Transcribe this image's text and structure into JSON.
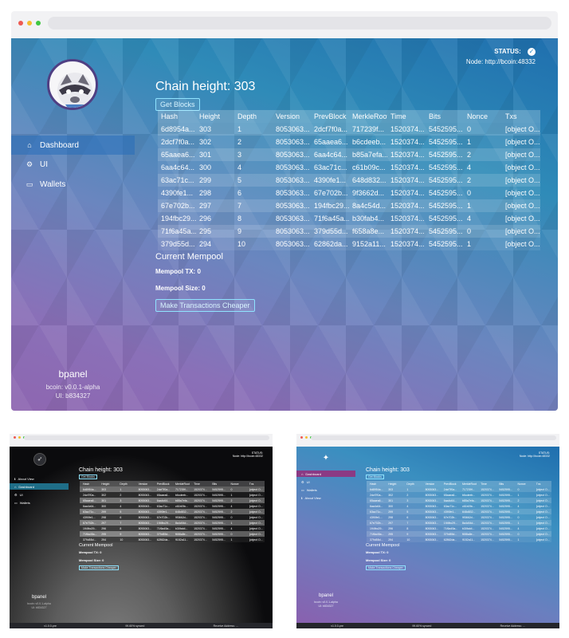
{
  "main": {
    "status_label": "STATUS:",
    "node_text": "Node: http://bcoin:48332",
    "nav": [
      {
        "label": "Dashboard",
        "icon": "home-icon",
        "glyph": "⌂"
      },
      {
        "label": "UI",
        "icon": "cogs-icon",
        "glyph": "⚙"
      },
      {
        "label": "Wallets",
        "icon": "wallet-icon",
        "glyph": "▭"
      }
    ],
    "brand": {
      "name": "bpanel",
      "bcoin_version": "bcoin: v0.0.1-alpha",
      "ui_version": "UI: b834327"
    },
    "chain_height_title": "Chain height: 303",
    "get_blocks_label": "Get Blocks",
    "columns": [
      "Hash",
      "Height",
      "Depth",
      "Version",
      "PrevBlock",
      "MerkleRoot",
      "Time",
      "Bits",
      "Nonce",
      "Txs"
    ],
    "rows": [
      [
        "6d8954a...",
        "303",
        "1",
        "8053063...",
        "2dcf7f0a...",
        "717239f...",
        "1520374...",
        "5452595...",
        "0",
        "[object O..."
      ],
      [
        "2dcf7f0a...",
        "302",
        "2",
        "8053063...",
        "65aaea6...",
        "b6cdeeb...",
        "1520374...",
        "5452595...",
        "1",
        "[object O..."
      ],
      [
        "65aaea6...",
        "301",
        "3",
        "8053063...",
        "6aa4c64...",
        "b85a7efa...",
        "1520374...",
        "5452595...",
        "2",
        "[object O..."
      ],
      [
        "6aa4c64...",
        "300",
        "4",
        "8053063...",
        "63ac71c...",
        "c61b09c...",
        "1520374...",
        "5452595...",
        "4",
        "[object O..."
      ],
      [
        "63ac71c...",
        "299",
        "5",
        "8053063...",
        "4390fe1...",
        "648d832...",
        "1520374...",
        "5452595...",
        "2",
        "[object O..."
      ],
      [
        "4390fe1...",
        "298",
        "6",
        "8053063...",
        "67e702b...",
        "9f3662d...",
        "1520374...",
        "5452595...",
        "0",
        "[object O..."
      ],
      [
        "67e702b...",
        "297",
        "7",
        "8053063...",
        "194fbc29...",
        "8a4c54d...",
        "1520374...",
        "5452595...",
        "1",
        "[object O..."
      ],
      [
        "194fbc29...",
        "296",
        "8",
        "8053063...",
        "71f6a45a...",
        "b30fab4...",
        "1520374...",
        "5452595...",
        "4",
        "[object O..."
      ],
      [
        "71f6a45a...",
        "295",
        "9",
        "8053063...",
        "379d55d...",
        "f658a8e...",
        "1520374...",
        "5452595...",
        "0",
        "[object O..."
      ],
      [
        "379d55d...",
        "294",
        "10",
        "8053063...",
        "62862da...",
        "9152a11...",
        "1520374...",
        "5452595...",
        "1",
        "[object O..."
      ]
    ],
    "mempool_title": "Current Mempool",
    "mempool_tx": "Mempool TX: 0",
    "mempool_size": "Mempool Size: 0",
    "cheaper_button": "Make Transactions Cheaper"
  },
  "dark_thumb": {
    "status_label": "STATUS:",
    "node_text": "Node: http://bcoin:48332",
    "nav": [
      {
        "label": "About View",
        "icon": "info-icon",
        "glyph": "ℹ"
      },
      {
        "label": "Dashboard",
        "icon": "home-icon",
        "glyph": "⌂"
      },
      {
        "label": "UI",
        "icon": "cogs-icon",
        "glyph": "⚙"
      },
      {
        "label": "Wallets",
        "icon": "wallet-icon",
        "glyph": "▭"
      }
    ],
    "active_index": 1,
    "brand": {
      "name": "bpanel",
      "bcoin_version": "bcoin: v0.0.1-alpha",
      "ui_version": "UI: b834327"
    },
    "chain_height_title": "Chain height: 303",
    "get_blocks_label": "Get Blocks",
    "mempool_title": "Current Mempool",
    "mempool_tx": "Mempool TX: 0",
    "mempool_size": "Mempool Size: 0",
    "cheaper_button": "Make Transactions Cheaper",
    "statusbar": [
      "v1.0.0-pre",
      "99.60% synced",
      "Receive Address: ..."
    ]
  },
  "blue_thumb": {
    "status_label": "STATUS:",
    "node_text": "Node: http://bcoin:48332",
    "nav": [
      {
        "label": "Dashboard",
        "icon": "home-icon",
        "glyph": "⌂"
      },
      {
        "label": "UI",
        "icon": "cogs-icon",
        "glyph": "⚙"
      },
      {
        "label": "Wallets",
        "icon": "wallet-icon",
        "glyph": "▭"
      },
      {
        "label": "About View",
        "icon": "info-icon",
        "glyph": "ℹ"
      }
    ],
    "active_index": 0,
    "brand": {
      "name": "bpanel",
      "bcoin_version": "bcoin: v0.0.1-alpha",
      "ui_version": "UI: b834327"
    },
    "chain_height_title": "Chain height: 303",
    "get_blocks_label": "Get Blocks",
    "mempool_title": "Current Mempool",
    "mempool_tx": "Mempool TX: 0",
    "mempool_size": "Mempool Size: 0",
    "cheaper_button": "Make Transactions Cheaper",
    "statusbar": [
      "v1.0.0-pre",
      "99.60% synced",
      "Receive Address: ..."
    ]
  },
  "colors": {
    "traffic_red": "#ee5a52",
    "traffic_yellow": "#f5bd2e",
    "traffic_green": "#3fc740",
    "button_outline": "#8fe3ff",
    "dark_active": "#1f6e88",
    "blue_active": "#8b3a84"
  }
}
